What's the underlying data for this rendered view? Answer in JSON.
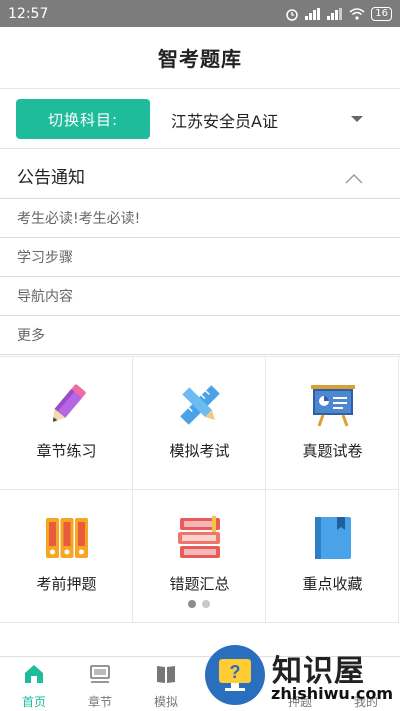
{
  "status": {
    "time": "12:57",
    "battery": "16"
  },
  "header": {
    "title": "智考题库"
  },
  "subject": {
    "switch_label": "切换科目:",
    "current": "江苏安全员A证"
  },
  "notice": {
    "title": "公告通知",
    "items": [
      "考生必读!考生必读!",
      "学习步骤",
      "导航内容",
      "更多"
    ]
  },
  "menu": [
    {
      "label": "章节练习",
      "icon": "pencil-icon"
    },
    {
      "label": "模拟考试",
      "icon": "ruler-pencil-icon"
    },
    {
      "label": "真题试卷",
      "icon": "presentation-board-icon"
    },
    {
      "label": "考前押题",
      "icon": "binders-icon"
    },
    {
      "label": "错题汇总",
      "icon": "books-stack-icon"
    },
    {
      "label": "重点收藏",
      "icon": "bookmark-book-icon"
    }
  ],
  "tabs": [
    "首页",
    "章节",
    "模拟",
    "押题",
    "我的"
  ],
  "watermark": {
    "text": "知识屋",
    "url": "zhishiwu.com"
  },
  "colors": {
    "accent": "#1fbc9c",
    "status_bar": "#7c7c7c"
  }
}
